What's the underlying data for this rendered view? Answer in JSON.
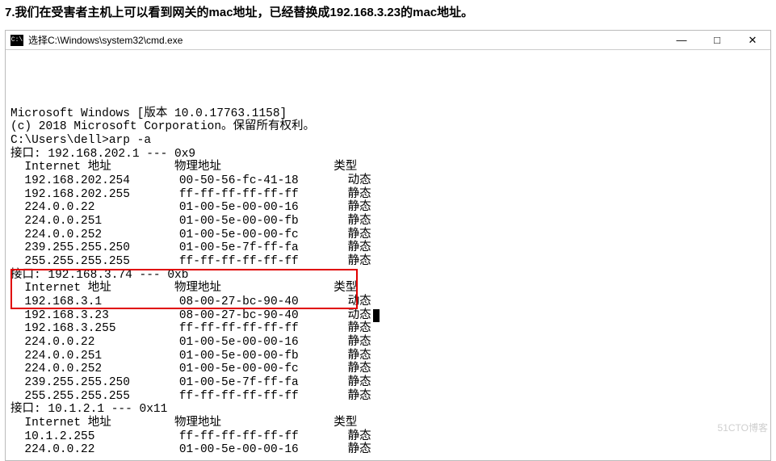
{
  "heading": "7.我们在受害者主机上可以看到网关的mac地址，已经替换成192.168.3.23的mac地址。",
  "window": {
    "title": "选择C:\\Windows\\system32\\cmd.exe",
    "icon_label": "C:\\",
    "controls": {
      "min": "—",
      "max": "□",
      "close": "✕"
    }
  },
  "terminal": {
    "banner1": "Microsoft Windows [版本 10.0.17763.1158]",
    "banner2": "(c) 2018 Microsoft Corporation。保留所有权利。",
    "prompt": "C:\\Users\\dell>arp -a",
    "iface1": {
      "header": "接口: 192.168.202.1 --- 0x9",
      "col_internet": "Internet 地址",
      "col_physical": "物理地址",
      "col_type": "类型",
      "rows": [
        {
          "ip": "192.168.202.254",
          "mac": "00-50-56-fc-41-18",
          "type": "动态"
        },
        {
          "ip": "192.168.202.255",
          "mac": "ff-ff-ff-ff-ff-ff",
          "type": "静态"
        },
        {
          "ip": "224.0.0.22",
          "mac": "01-00-5e-00-00-16",
          "type": "静态"
        },
        {
          "ip": "224.0.0.251",
          "mac": "01-00-5e-00-00-fb",
          "type": "静态"
        },
        {
          "ip": "224.0.0.252",
          "mac": "01-00-5e-00-00-fc",
          "type": "静态"
        },
        {
          "ip": "239.255.255.250",
          "mac": "01-00-5e-7f-ff-fa",
          "type": "静态"
        },
        {
          "ip": "255.255.255.255",
          "mac": "ff-ff-ff-ff-ff-ff",
          "type": "静态"
        }
      ]
    },
    "iface2": {
      "header": "接口: 192.168.3.74 --- 0xb",
      "col_internet": "Internet 地址",
      "col_physical": "物理地址",
      "col_type": "类型",
      "rows": [
        {
          "ip": "192.168.3.1",
          "mac": "08-00-27-bc-90-40",
          "type": "动态"
        },
        {
          "ip": "192.168.3.23",
          "mac": "08-00-27-bc-90-40",
          "type": "动态"
        },
        {
          "ip": "192.168.3.255",
          "mac": "ff-ff-ff-ff-ff-ff",
          "type": "静态"
        },
        {
          "ip": "224.0.0.22",
          "mac": "01-00-5e-00-00-16",
          "type": "静态"
        },
        {
          "ip": "224.0.0.251",
          "mac": "01-00-5e-00-00-fb",
          "type": "静态"
        },
        {
          "ip": "224.0.0.252",
          "mac": "01-00-5e-00-00-fc",
          "type": "静态"
        },
        {
          "ip": "239.255.255.250",
          "mac": "01-00-5e-7f-ff-fa",
          "type": "静态"
        },
        {
          "ip": "255.255.255.255",
          "mac": "ff-ff-ff-ff-ff-ff",
          "type": "静态"
        }
      ]
    },
    "iface3": {
      "header": "接口: 10.1.2.1 --- 0x11",
      "col_internet": "Internet 地址",
      "col_physical": "物理地址",
      "col_type": "类型",
      "rows": [
        {
          "ip": "10.1.2.255",
          "mac": "ff-ff-ff-ff-ff-ff",
          "type": "静态"
        },
        {
          "ip": "224.0.0.22",
          "mac": "01-00-5e-00-00-16",
          "type": "静态"
        }
      ]
    }
  },
  "watermark": "51CTO博客"
}
